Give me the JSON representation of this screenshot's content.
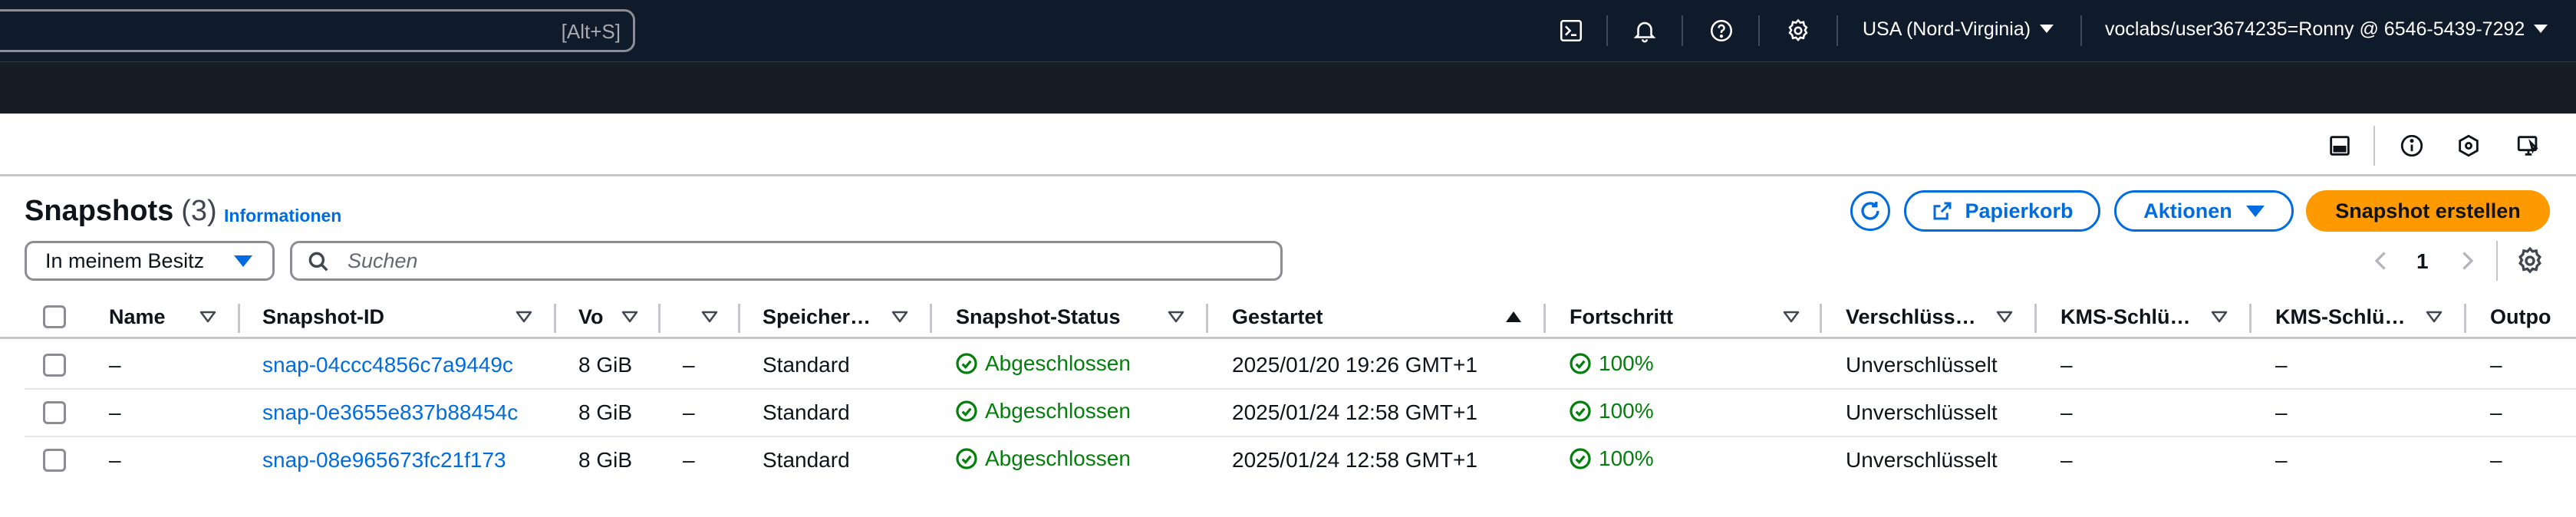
{
  "topnav": {
    "search_shortcut": "[Alt+S]",
    "region": "USA (Nord-Virginia)",
    "account": "voclabs/user3674235=Ronny @ 6546-5439-7292"
  },
  "header": {
    "title": "Snapshots",
    "count": "(3)",
    "info_link": "Informationen"
  },
  "actions": {
    "recycle_bin": "Papierkorb",
    "actions": "Aktionen",
    "create": "Snapshot erstellen"
  },
  "filter": {
    "owner": "In meinem Besitz",
    "search_placeholder": "Suchen"
  },
  "pagination": {
    "current_page": "1"
  },
  "table": {
    "columns": [
      "Name",
      "Snapshot-ID",
      "Vo",
      "",
      "Speicher…",
      "Snapshot-Status",
      "Gestartet",
      "Fortschritt",
      "Verschlüss…",
      "KMS-Schlü…",
      "KMS-Schlü…",
      "Outpo"
    ],
    "rows": [
      {
        "name": "–",
        "id": "snap-04ccc4856c7a9449c",
        "volume": "8 GiB",
        "extra": "–",
        "storage": "Standard",
        "status": "Abgeschlossen",
        "started": "2025/01/20 19:26 GMT+1",
        "progress": "100%",
        "encryption": "Unverschlüsselt",
        "kms1": "–",
        "kms2": "–",
        "outpost": "–"
      },
      {
        "name": "–",
        "id": "snap-0e3655e837b88454c",
        "volume": "8 GiB",
        "extra": "–",
        "storage": "Standard",
        "status": "Abgeschlossen",
        "started": "2025/01/24 12:58 GMT+1",
        "progress": "100%",
        "encryption": "Unverschlüsselt",
        "kms1": "–",
        "kms2": "–",
        "outpost": "–"
      },
      {
        "name": "–",
        "id": "snap-08e965673fc21f173",
        "volume": "8 GiB",
        "extra": "–",
        "storage": "Standard",
        "status": "Abgeschlossen",
        "started": "2025/01/24 12:58 GMT+1",
        "progress": "100%",
        "encryption": "Unverschlüsselt",
        "kms1": "–",
        "kms2": "–",
        "outpost": "–"
      }
    ]
  },
  "colors": {
    "nav_bg": "#0f1b2a",
    "link": "#006ce0",
    "primary": "#ff9900",
    "success": "#037f0c"
  }
}
